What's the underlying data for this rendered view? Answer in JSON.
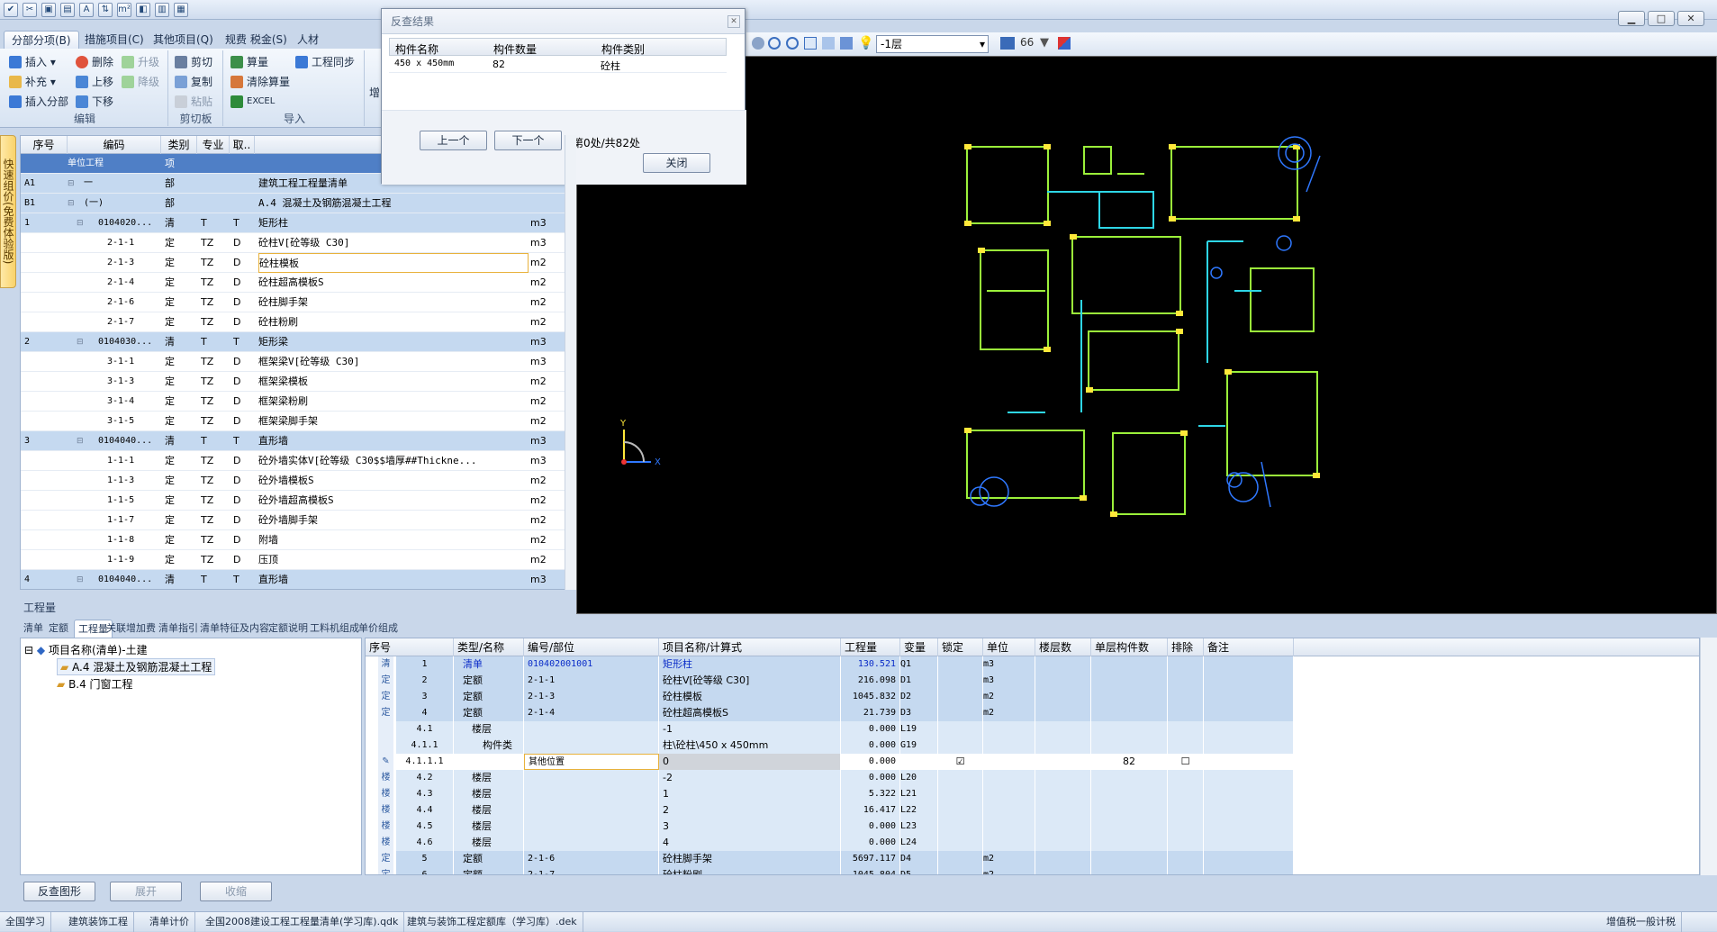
{
  "quick_access": [
    "✔",
    "✂",
    "▣",
    "▤",
    "A",
    "⇅",
    "m²",
    "◧",
    "▥",
    "▦"
  ],
  "menu_tabs": [
    "分部分项(B)",
    "措施项目(C)",
    "其他项目(Q)",
    "规费 税金(S)",
    "人材"
  ],
  "ribbon": {
    "edit": {
      "insert": "插入",
      "delete": "删除",
      "upgrade": "升级",
      "supplement": "补充",
      "move_up": "上移",
      "downgrade": "降级",
      "insert_part": "插入分部",
      "move_down": "下移",
      "label": "编辑"
    },
    "clipboard": {
      "cut": "剪切",
      "copy": "复制",
      "paste": "粘贴",
      "label": "剪切板"
    },
    "import": {
      "calc": "算量",
      "sync": "工程同步",
      "clear_calc": "清除算量",
      "excel": "EXCEL",
      "label": "导入"
    },
    "extra": "增"
  },
  "vertical_tab": "快速组价(免费体验版)",
  "grid": {
    "headers": [
      "序号",
      "编码",
      "类别",
      "专业",
      "取..",
      "项"
    ],
    "rows": [
      {
        "seq": "",
        "code": "单位工程",
        "type": "项",
        "major": "",
        "take": "",
        "name": "",
        "unit": "",
        "level": "head"
      },
      {
        "seq": "A1",
        "code": "一",
        "type": "部",
        "major": "",
        "take": "",
        "name": "建筑工程工程量清单",
        "unit": "",
        "level": "part"
      },
      {
        "seq": "B1",
        "code": "(一)",
        "type": "部",
        "major": "",
        "take": "",
        "name": "A.4 混凝土及钢筋混凝土工程",
        "unit": "",
        "level": "part"
      },
      {
        "seq": "1",
        "code": "0104020...",
        "type": "清",
        "major": "T",
        "take": "T",
        "name": "矩形柱",
        "unit": "m3",
        "level": "qd"
      },
      {
        "seq": "",
        "code": "2-1-1",
        "type": "定",
        "major": "TZ",
        "take": "D",
        "name": "砼柱V[砼等级 C30]",
        "unit": "m3",
        "level": "de"
      },
      {
        "seq": "",
        "code": "2-1-3",
        "type": "定",
        "major": "TZ",
        "take": "D",
        "name": "砼柱模板",
        "unit": "m2",
        "level": "de"
      },
      {
        "seq": "",
        "code": "2-1-4",
        "type": "定",
        "major": "TZ",
        "take": "D",
        "name": "砼柱超高模板S",
        "unit": "m2",
        "level": "de"
      },
      {
        "seq": "",
        "code": "2-1-6",
        "type": "定",
        "major": "TZ",
        "take": "D",
        "name": "砼柱脚手架",
        "unit": "m2",
        "level": "de"
      },
      {
        "seq": "",
        "code": "2-1-7",
        "type": "定",
        "major": "TZ",
        "take": "D",
        "name": "砼柱粉刷",
        "unit": "m2",
        "level": "de"
      },
      {
        "seq": "2",
        "code": "0104030...",
        "type": "清",
        "major": "T",
        "take": "T",
        "name": "矩形梁",
        "unit": "m3",
        "level": "qd"
      },
      {
        "seq": "",
        "code": "3-1-1",
        "type": "定",
        "major": "TZ",
        "take": "D",
        "name": "框架梁V[砼等级 C30]",
        "unit": "m3",
        "level": "de"
      },
      {
        "seq": "",
        "code": "3-1-3",
        "type": "定",
        "major": "TZ",
        "take": "D",
        "name": "框架梁模板",
        "unit": "m2",
        "level": "de"
      },
      {
        "seq": "",
        "code": "3-1-4",
        "type": "定",
        "major": "TZ",
        "take": "D",
        "name": "框架梁粉刷",
        "unit": "m2",
        "level": "de"
      },
      {
        "seq": "",
        "code": "3-1-5",
        "type": "定",
        "major": "TZ",
        "take": "D",
        "name": "框架梁脚手架",
        "unit": "m2",
        "level": "de"
      },
      {
        "seq": "3",
        "code": "0104040...",
        "type": "清",
        "major": "T",
        "take": "T",
        "name": "直形墙",
        "unit": "m3",
        "level": "qd"
      },
      {
        "seq": "",
        "code": "1-1-1",
        "type": "定",
        "major": "TZ",
        "take": "D",
        "name": "砼外墙实体V[砼等级 C30$$墙厚##Thickne...",
        "unit": "m3",
        "level": "de"
      },
      {
        "seq": "",
        "code": "1-1-3",
        "type": "定",
        "major": "TZ",
        "take": "D",
        "name": "砼外墙模板S",
        "unit": "m2",
        "level": "de"
      },
      {
        "seq": "",
        "code": "1-1-5",
        "type": "定",
        "major": "TZ",
        "take": "D",
        "name": "砼外墙超高模板S",
        "unit": "m2",
        "level": "de"
      },
      {
        "seq": "",
        "code": "1-1-7",
        "type": "定",
        "major": "TZ",
        "take": "D",
        "name": "砼外墙脚手架",
        "unit": "m2",
        "level": "de"
      },
      {
        "seq": "",
        "code": "1-1-8",
        "type": "定",
        "major": "TZ",
        "take": "D",
        "name": "附墙",
        "unit": "m2",
        "level": "de"
      },
      {
        "seq": "",
        "code": "1-1-9",
        "type": "定",
        "major": "TZ",
        "take": "D",
        "name": "压顶",
        "unit": "m2",
        "level": "de"
      },
      {
        "seq": "4",
        "code": "0104040...",
        "type": "清",
        "major": "T",
        "take": "T",
        "name": "直形墙",
        "unit": "m3",
        "level": "qd"
      }
    ]
  },
  "dialog": {
    "title": "反查结果",
    "headers": [
      "构件名称",
      "构件数量",
      "构件类别"
    ],
    "row": {
      "name": "450 x 450mm",
      "count": "82",
      "category": "砼柱"
    },
    "prev": "上一个",
    "next": "下一个",
    "counter": "第0处/共82处",
    "close": "关闭"
  },
  "cad_toolbar": {
    "floor": "-1层"
  },
  "bottom": {
    "title": "工程量",
    "tabs": [
      "清单",
      "定额",
      "工程量",
      "关联增加费",
      "清单指引",
      "清单特征及内容",
      "定额说明",
      "工料机组成",
      "单价组成"
    ],
    "tree": {
      "root": "项目名称(清单)-土建",
      "a4": "A.4 混凝土及钢筋混凝土工程",
      "b4": "B.4 门窗工程"
    },
    "headers": [
      "序号",
      "类型/名称",
      "编号/部位",
      "项目名称/计算式",
      "工程量",
      "变量",
      "锁定",
      "单位",
      "楼层数",
      "单层构件数",
      "排除",
      "备注"
    ],
    "rows": [
      {
        "icon": "清",
        "seq": "1",
        "type": "清单",
        "code": "010402001001",
        "name": "矩形柱",
        "qty": "130.521",
        "var": "Q1",
        "lock": "",
        "unit": "m3",
        "floors": "",
        "per": "",
        "excl": "",
        "note": "",
        "style": "qd"
      },
      {
        "icon": "定",
        "seq": "2",
        "type": "定额",
        "code": "2-1-1",
        "name": "砼柱V[砼等级 C30]",
        "qty": "216.098",
        "var": "D1",
        "lock": "",
        "unit": "m3",
        "floors": "",
        "per": "",
        "excl": "",
        "note": "",
        "style": "de"
      },
      {
        "icon": "定",
        "seq": "3",
        "type": "定额",
        "code": "2-1-3",
        "name": "砼柱模板",
        "qty": "1045.832",
        "var": "D2",
        "lock": "",
        "unit": "m2",
        "floors": "",
        "per": "",
        "excl": "",
        "note": "",
        "style": "de"
      },
      {
        "icon": "定",
        "seq": "4",
        "type": "定额",
        "code": "2-1-4",
        "name": "砼柱超高模板S",
        "qty": "21.739",
        "var": "D3",
        "lock": "",
        "unit": "m2",
        "floors": "",
        "per": "",
        "excl": "",
        "note": "",
        "style": "de"
      },
      {
        "icon": "",
        "seq": "4.1",
        "type": "楼层",
        "code": "",
        "name": "-1",
        "qty": "0.000",
        "var": "L19",
        "lock": "",
        "unit": "",
        "floors": "",
        "per": "",
        "excl": "",
        "note": "",
        "style": "lv"
      },
      {
        "icon": "",
        "seq": "4.1.1",
        "type": "构件类",
        "code": "",
        "name": "柱\\砼柱\\450 x 450mm",
        "qty": "0.000",
        "var": "G19",
        "lock": "",
        "unit": "",
        "floors": "",
        "per": "",
        "excl": "",
        "note": "",
        "style": "lv"
      },
      {
        "icon": "✎",
        "seq": "4.1.1.1",
        "type": "",
        "code": "其他位置",
        "name": "0",
        "qty": "0.000",
        "var": "",
        "lock": "☑",
        "unit": "",
        "floors": "",
        "per": "82",
        "excl": "☐",
        "note": "",
        "style": "cur"
      },
      {
        "icon": "楼",
        "seq": "4.2",
        "type": "楼层",
        "code": "",
        "name": "-2",
        "qty": "0.000",
        "var": "L20",
        "lock": "",
        "unit": "",
        "floors": "",
        "per": "",
        "excl": "",
        "note": "",
        "style": "lv"
      },
      {
        "icon": "楼",
        "seq": "4.3",
        "type": "楼层",
        "code": "",
        "name": "1",
        "qty": "5.322",
        "var": "L21",
        "lock": "",
        "unit": "",
        "floors": "",
        "per": "",
        "excl": "",
        "note": "",
        "style": "lv"
      },
      {
        "icon": "楼",
        "seq": "4.4",
        "type": "楼层",
        "code": "",
        "name": "2",
        "qty": "16.417",
        "var": "L22",
        "lock": "",
        "unit": "",
        "floors": "",
        "per": "",
        "excl": "",
        "note": "",
        "style": "lv"
      },
      {
        "icon": "楼",
        "seq": "4.5",
        "type": "楼层",
        "code": "",
        "name": "3",
        "qty": "0.000",
        "var": "L23",
        "lock": "",
        "unit": "",
        "floors": "",
        "per": "",
        "excl": "",
        "note": "",
        "style": "lv"
      },
      {
        "icon": "楼",
        "seq": "4.6",
        "type": "楼层",
        "code": "",
        "name": "4",
        "qty": "0.000",
        "var": "L24",
        "lock": "",
        "unit": "",
        "floors": "",
        "per": "",
        "excl": "",
        "note": "",
        "style": "lv"
      },
      {
        "icon": "定",
        "seq": "5",
        "type": "定额",
        "code": "2-1-6",
        "name": "砼柱脚手架",
        "qty": "5697.117",
        "var": "D4",
        "lock": "",
        "unit": "m2",
        "floors": "",
        "per": "",
        "excl": "",
        "note": "",
        "style": "de"
      },
      {
        "icon": "定",
        "seq": "6",
        "type": "定额",
        "code": "2-1-7",
        "name": "砼柱粉刷",
        "qty": "1045.804",
        "var": "D5",
        "lock": "",
        "unit": "m2",
        "floors": "",
        "per": "",
        "excl": "",
        "note": "",
        "style": "de"
      }
    ],
    "buttons": {
      "reverse": "反查图形",
      "expand": "展开",
      "collapse": "收缩"
    }
  },
  "status": [
    "全国学习",
    "建筑装饰工程",
    "清单计价",
    "全国2008建设工程工程量清单(学习库).qdk",
    "建筑与装饰工程定额库（学习库）.dek",
    "增值税一般计税"
  ],
  "colors": {
    "header_row": "#b5cde8",
    "qd_row": "#c5d9f0",
    "de_row": "#dce9f7",
    "highlight": "#0a2cc8",
    "cad_green": "#9bf03a",
    "cad_cyan": "#2ed6e6",
    "cad_yellow": "#ffe83a",
    "cad_blue": "#2f78ff"
  }
}
